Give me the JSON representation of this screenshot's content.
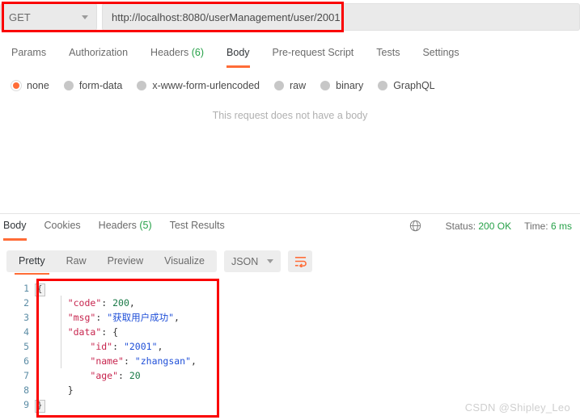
{
  "request": {
    "method": "GET",
    "url": "http://localhost:8080/userManagement/user/2001",
    "tabs": [
      {
        "label": "Params",
        "count": "",
        "active": false
      },
      {
        "label": "Authorization",
        "count": "",
        "active": false
      },
      {
        "label": "Headers",
        "count": "(6)",
        "active": false
      },
      {
        "label": "Body",
        "count": "",
        "active": true
      },
      {
        "label": "Pre-request Script",
        "count": "",
        "active": false
      },
      {
        "label": "Tests",
        "count": "",
        "active": false
      },
      {
        "label": "Settings",
        "count": "",
        "active": false
      }
    ],
    "body_types": [
      {
        "label": "none",
        "selected": true
      },
      {
        "label": "form-data",
        "selected": false
      },
      {
        "label": "x-www-form-urlencoded",
        "selected": false
      },
      {
        "label": "raw",
        "selected": false
      },
      {
        "label": "binary",
        "selected": false
      },
      {
        "label": "GraphQL",
        "selected": false
      }
    ],
    "empty_body_message": "This request does not have a body"
  },
  "response": {
    "tabs": [
      {
        "label": "Body",
        "count": "",
        "active": true
      },
      {
        "label": "Cookies",
        "count": "",
        "active": false
      },
      {
        "label": "Headers",
        "count": "(5)",
        "active": false
      },
      {
        "label": "Test Results",
        "count": "",
        "active": false
      }
    ],
    "status_label": "Status:",
    "status_value": "200 OK",
    "time_label": "Time:",
    "time_value": "6 ms",
    "view_modes": [
      {
        "label": "Pretty",
        "active": true
      },
      {
        "label": "Raw",
        "active": false
      },
      {
        "label": "Preview",
        "active": false
      },
      {
        "label": "Visualize",
        "active": false
      }
    ],
    "format": "JSON",
    "body_lines": [
      {
        "num": "1",
        "fold": "{",
        "segments": []
      },
      {
        "num": "2",
        "fold": "",
        "segments": [
          {
            "t": "    ",
            "c": "p"
          },
          {
            "t": "\"code\"",
            "c": "k"
          },
          {
            "t": ": ",
            "c": "p"
          },
          {
            "t": "200",
            "c": "n"
          },
          {
            "t": ",",
            "c": "p"
          }
        ]
      },
      {
        "num": "3",
        "fold": "",
        "segments": [
          {
            "t": "    ",
            "c": "p"
          },
          {
            "t": "\"msg\"",
            "c": "k"
          },
          {
            "t": ": ",
            "c": "p"
          },
          {
            "t": "\"获取用户成功\"",
            "c": "s"
          },
          {
            "t": ",",
            "c": "p"
          }
        ]
      },
      {
        "num": "4",
        "fold": "",
        "segments": [
          {
            "t": "    ",
            "c": "p"
          },
          {
            "t": "\"data\"",
            "c": "k"
          },
          {
            "t": ": {",
            "c": "p"
          }
        ]
      },
      {
        "num": "5",
        "fold": "",
        "segments": [
          {
            "t": "        ",
            "c": "p"
          },
          {
            "t": "\"id\"",
            "c": "k"
          },
          {
            "t": ": ",
            "c": "p"
          },
          {
            "t": "\"2001\"",
            "c": "s"
          },
          {
            "t": ",",
            "c": "p"
          }
        ]
      },
      {
        "num": "6",
        "fold": "",
        "segments": [
          {
            "t": "        ",
            "c": "p"
          },
          {
            "t": "\"name\"",
            "c": "k"
          },
          {
            "t": ": ",
            "c": "p"
          },
          {
            "t": "\"zhangsan\"",
            "c": "s"
          },
          {
            "t": ",",
            "c": "p"
          }
        ]
      },
      {
        "num": "7",
        "fold": "",
        "segments": [
          {
            "t": "        ",
            "c": "p"
          },
          {
            "t": "\"age\"",
            "c": "k"
          },
          {
            "t": ": ",
            "c": "p"
          },
          {
            "t": "20",
            "c": "n"
          }
        ]
      },
      {
        "num": "8",
        "fold": "",
        "segments": [
          {
            "t": "    }",
            "c": "p"
          }
        ]
      },
      {
        "num": "9",
        "fold": "}",
        "segments": []
      }
    ]
  },
  "annotations": {
    "accent_color": "#ff6c37",
    "highlight_color": "#fa0000",
    "success_color": "#26a148"
  },
  "watermark": "CSDN @Shipley_Leo"
}
